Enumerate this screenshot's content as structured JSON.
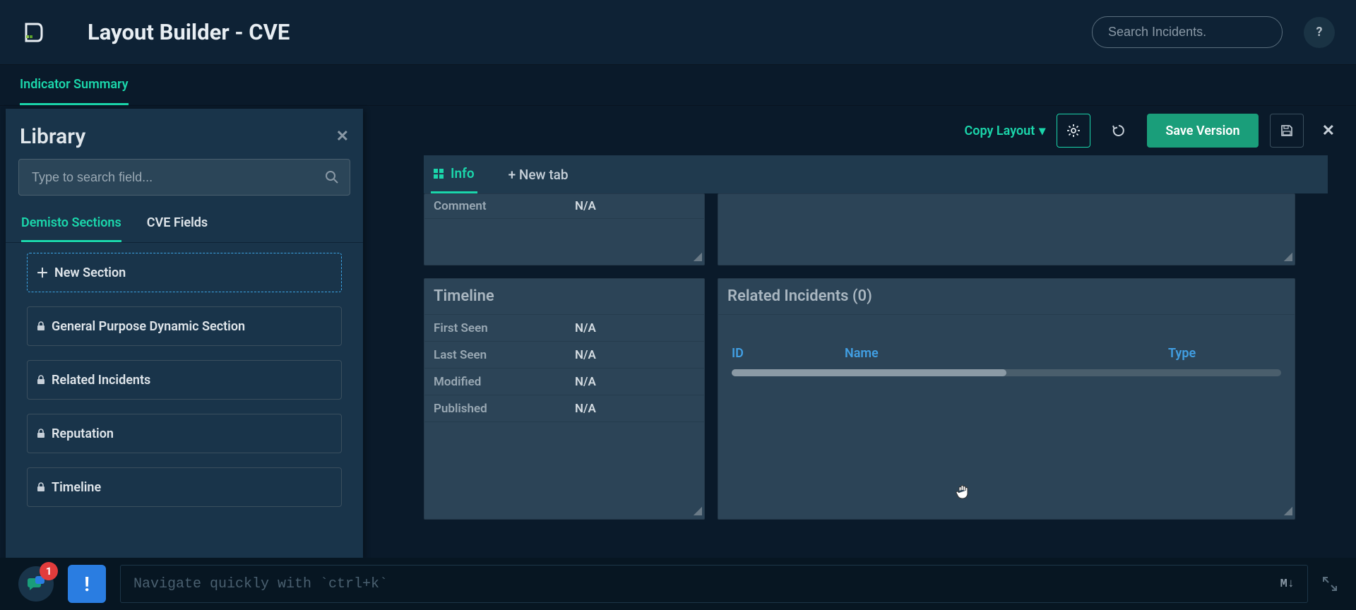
{
  "header": {
    "title": "Layout Builder - CVE",
    "search_placeholder": "Search Incidents.",
    "help": "?"
  },
  "subtab": {
    "label": "Indicator Summary"
  },
  "library": {
    "title": "Library",
    "search_placeholder": "Type to search field...",
    "tabs": [
      "Demisto Sections",
      "CVE Fields"
    ],
    "new_section": "New Section",
    "items": [
      "General Purpose Dynamic Section",
      "Related Incidents",
      "Reputation",
      "Timeline"
    ]
  },
  "toolbar": {
    "copy_layout": "Copy Layout",
    "save_version": "Save Version"
  },
  "layout_tabs": {
    "active": "Info",
    "new_tab": "+ New tab"
  },
  "cards": {
    "comment": {
      "label": "Comment",
      "value": "N/A"
    },
    "timeline": {
      "title": "Timeline",
      "rows": [
        {
          "k": "First Seen",
          "v": "N/A"
        },
        {
          "k": "Last Seen",
          "v": "N/A"
        },
        {
          "k": "Modified",
          "v": "N/A"
        },
        {
          "k": "Published",
          "v": "N/A"
        }
      ]
    },
    "related": {
      "title": "Related Incidents (0)",
      "cols": [
        "ID",
        "Name",
        "Type"
      ]
    }
  },
  "footer": {
    "badge": "1",
    "bang": "!",
    "cli_hint": "Navigate quickly with `ctrl+k`",
    "md": "M↓"
  }
}
